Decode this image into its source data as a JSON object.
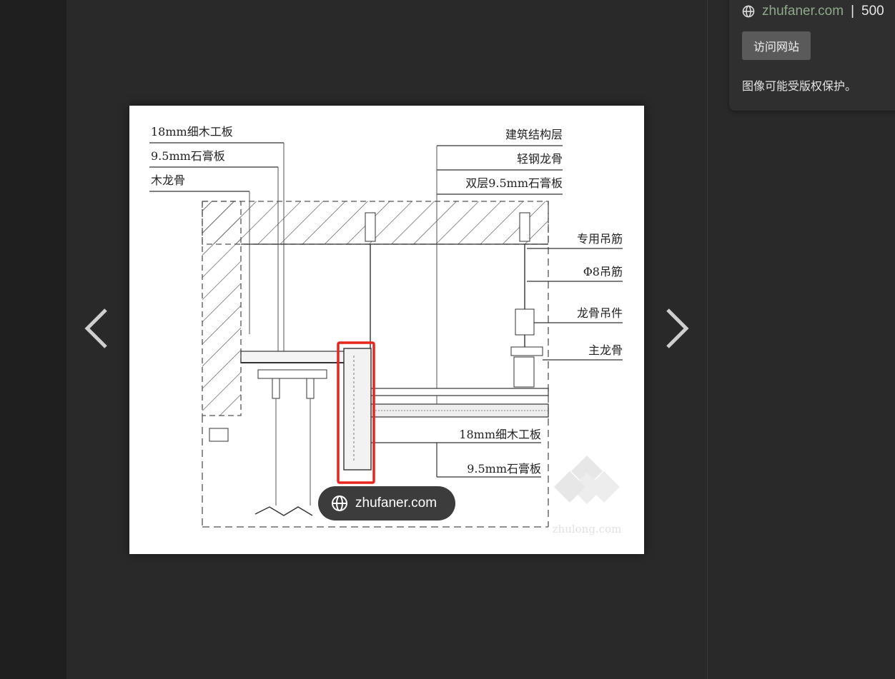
{
  "source": {
    "domain": "zhufaner.com",
    "separator": "|",
    "size_fragment": "500",
    "visit_button": "访问网站",
    "copyright_notice": "图像可能受版权保护。"
  },
  "image": {
    "overlay_domain": "zhufaner.com",
    "watermark": "zhulong.com",
    "labels_top_left": [
      "18mm细木工板",
      "9.5mm石膏板",
      "木龙骨"
    ],
    "labels_top_right": [
      "建筑结构层",
      "轻钢龙骨",
      "双层9.5mm石膏板"
    ],
    "labels_right": [
      "专用吊筋",
      "Φ8吊筋",
      "龙骨吊件",
      "主龙骨"
    ],
    "labels_bottom_right": [
      "18mm细木工板",
      "9.5mm石膏板"
    ],
    "highlight_color": "#e8241c"
  },
  "icons": {
    "prev": "chevron-left-icon",
    "next": "chevron-right-icon",
    "globe": "globe-icon"
  }
}
